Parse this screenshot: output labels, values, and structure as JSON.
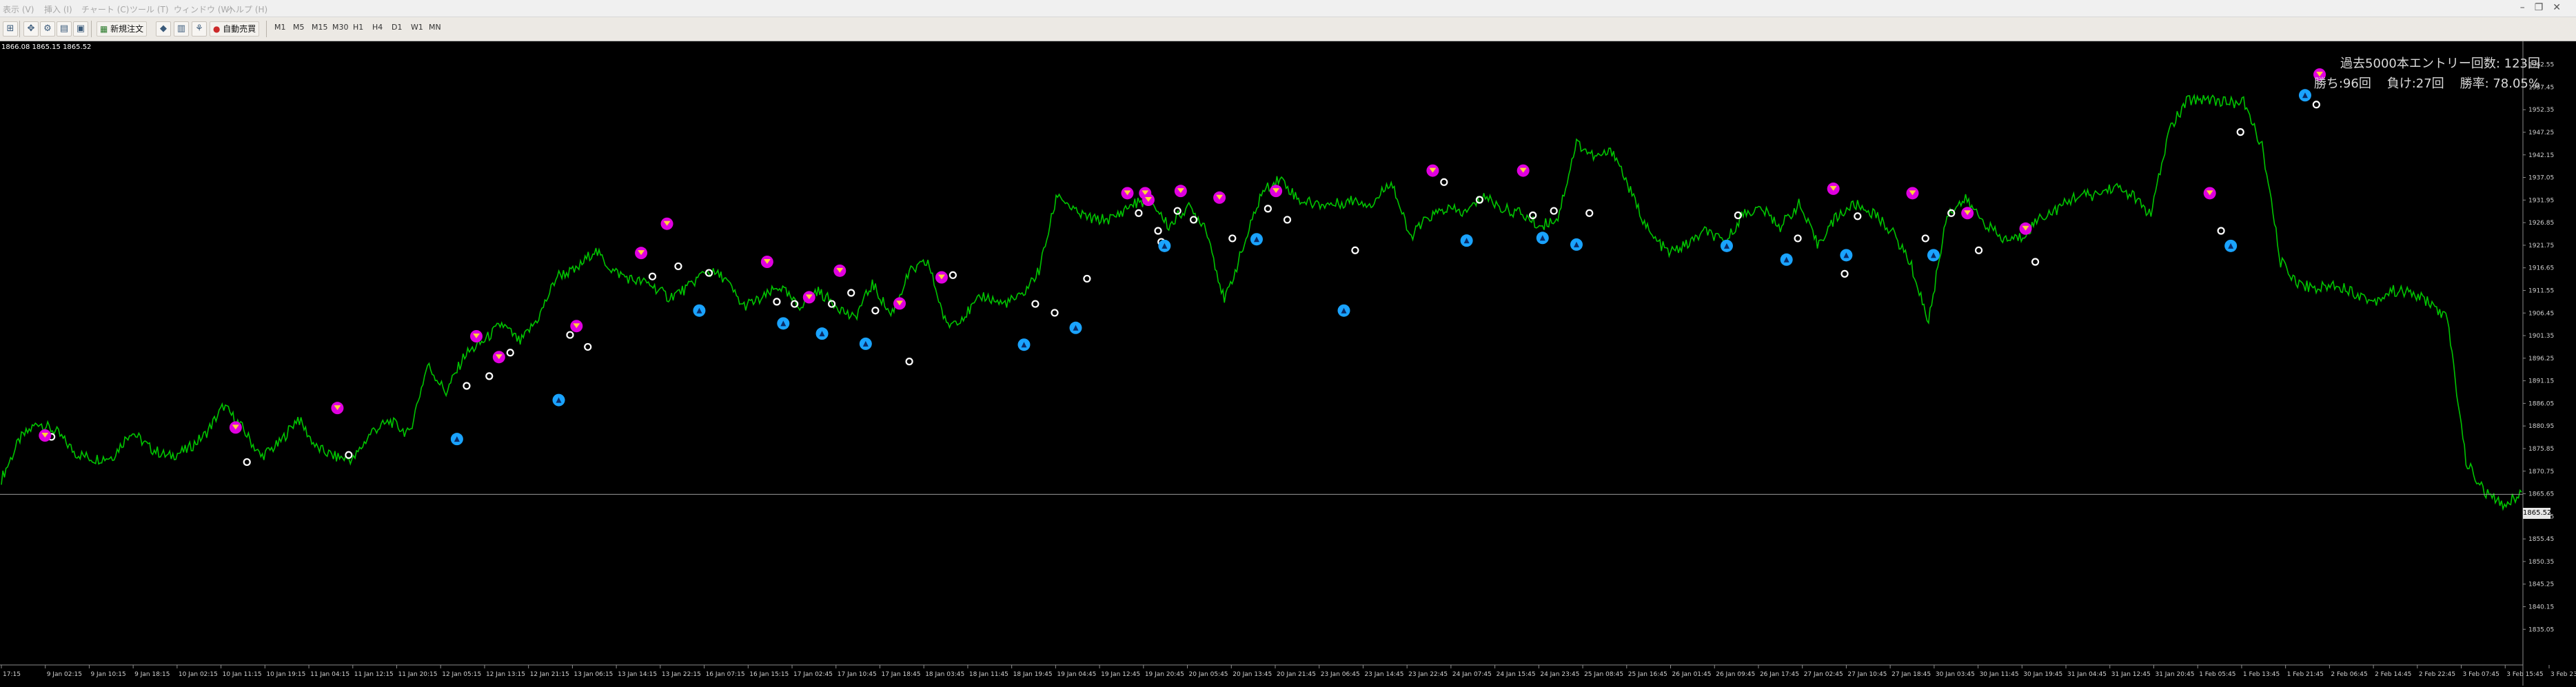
{
  "menu": [
    "表示 (V)",
    "挿入 (I)",
    "チャート (C)",
    "ツール (T)",
    "ウィンドウ (W)",
    "ヘルプ (H)"
  ],
  "window_controls": [
    "–",
    "❐",
    "✕"
  ],
  "toolbar": {
    "new_order_label": "新規注文",
    "auto_trade_label": "自動売買",
    "timeframes": [
      "M1",
      "M5",
      "M15",
      "M30",
      "H1",
      "H4",
      "D1",
      "W1",
      "MN"
    ]
  },
  "chart": {
    "ohlc_text": "1866.08 1865.15 1865.52",
    "current_price": "1865.52",
    "stats": {
      "line1": "過去5000本エントリー回数: 123回",
      "line2": "勝ち:96回    負け:27回    勝率: 78.05%"
    },
    "colors": {
      "background": "#000000",
      "candles": "#00c400",
      "sell_marker": "#e000e0",
      "buy_marker": "#1aa3ff",
      "exit_marker": "#ffffff"
    }
  },
  "chart_data": {
    "type": "line",
    "title": "",
    "series": [
      {
        "name": "",
        "values": [
          1869.0,
          1878.0,
          1881.8,
          1879.5,
          1874.8,
          1873.5,
          1874.0,
          1879.8,
          1876.0,
          1874.0,
          1875.5,
          1879.0,
          1885.5,
          1880.5,
          1874.0,
          1877.0,
          1882.8,
          1876.0,
          1874.0,
          1873.4,
          1879.8,
          1882.0,
          1879.0,
          1894.8,
          1888.5,
          1897.0,
          1900.0,
          1904.0,
          1899.8,
          1905.5,
          1915.0,
          1916.0,
          1920.7,
          1916.0,
          1914.0,
          1913.0,
          1910.0,
          1912.0,
          1916.0,
          1914.5,
          1908.0,
          1909.5,
          1912.5,
          1907.8,
          1911.5,
          1908.5,
          1905.0,
          1913.0,
          1906.0,
          1915.6,
          1918.0,
          1903.5,
          1906.0,
          1910.4,
          1908.5,
          1910.0,
          1916.0,
          1933.5,
          1929.0,
          1927.5,
          1927.8,
          1931.0,
          1932.0,
          1926.0,
          1930.5,
          1926.0,
          1909.0,
          1921.0,
          1933.5,
          1937.0,
          1932.0,
          1931.0,
          1931.0,
          1932.0,
          1931.0,
          1936.5,
          1923.5,
          1928.0,
          1930.0,
          1929.0,
          1933.0,
          1930.0,
          1929.0,
          1926.0,
          1928.0,
          1945.0,
          1941.5,
          1943.0,
          1933.0,
          1924.0,
          1920.0,
          1922.0,
          1925.0,
          1922.0,
          1929.0,
          1930.0,
          1926.0,
          1931.0,
          1922.0,
          1928.0,
          1931.0,
          1929.0,
          1925.0,
          1918.0,
          1904.5,
          1929.0,
          1932.0,
          1927.0,
          1923.0,
          1923.5,
          1928.0,
          1930.0,
          1933.0,
          1933.0,
          1935.0,
          1933.0,
          1928.5,
          1948.0,
          1954.5,
          1955.0,
          1954.0,
          1954.0,
          1944.0,
          1918.0,
          1913.0,
          1912.0,
          1913.0,
          1911.0,
          1909.0,
          1911.5,
          1911.0,
          1909.0,
          1905.0,
          1873.0,
          1866.0,
          1863.0,
          1866.0
        ]
      }
    ],
    "ylim": [
      1827.0,
      1967.0
    ],
    "y_ticks": [
      "1962.55",
      "1957.45",
      "1952.35",
      "1947.25",
      "1942.15",
      "1937.05",
      "1931.95",
      "1926.85",
      "1921.75",
      "1916.65",
      "1911.55",
      "1906.45",
      "1901.35",
      "1896.25",
      "1891.15",
      "1886.05",
      "1880.95",
      "1875.85",
      "1870.75",
      "1865.65",
      "1860.55",
      "1855.45",
      "1850.35",
      "1845.25",
      "1840.15",
      "1835.05"
    ],
    "x_ticks": [
      "9 Jan 02:15",
      "9 Jan 10:15",
      "9 Jan 18:15",
      "10 Jan 02:15",
      "10 Jan 11:15",
      "10 Jan 19:15",
      "11 Jan 04:15",
      "11 Jan 12:15",
      "11 Jan 20:15",
      "12 Jan 05:15",
      "12 Jan 13:15",
      "12 Jan 21:15",
      "13 Jan 06:15",
      "13 Jan 14:15",
      "13 Jan 22:15",
      "16 Jan 07:15",
      "16 Jan 15:15",
      "17 Jan 02:45",
      "17 Jan 10:45",
      "17 Jan 18:45",
      "18 Jan 03:45",
      "18 Jan 11:45",
      "18 Jan 19:45",
      "19 Jan 04:45",
      "19 Jan 12:45",
      "19 Jan 20:45",
      "20 Jan 05:45",
      "20 Jan 13:45",
      "20 Jan 21:45",
      "23 Jan 06:45",
      "23 Jan 14:45",
      "23 Jan 22:45",
      "24 Jan 07:45",
      "24 Jan 15:45",
      "24 Jan 23:45",
      "25 Jan 08:45",
      "25 Jan 16:45",
      "26 Jan 01:45",
      "26 Jan 09:45",
      "26 Jan 17:45",
      "27 Jan 02:45",
      "27 Jan 10:45",
      "27 Jan 18:45",
      "30 Jan 03:45",
      "30 Jan 11:45",
      "30 Jan 19:45",
      "31 Jan 04:45",
      "31 Jan 12:45",
      "31 Jan 20:45",
      "1 Feb 05:45",
      "1 Feb 13:45",
      "1 Feb 21:45",
      "2 Feb 06:45",
      "2 Feb 14:45",
      "2 Feb 22:45",
      "3 Feb 07:45",
      "3 Feb 15:45"
    ],
    "first_x_label": "17:15",
    "last_x_label": "3 Feb 23:",
    "legend": "none",
    "grid": false,
    "markers": {
      "sell_signals": [
        [
          27,
          1878.8
        ],
        [
          145,
          1880.6
        ],
        [
          208,
          1885.0
        ],
        [
          294,
          1901.2
        ],
        [
          308,
          1896.5
        ],
        [
          356,
          1903.5
        ],
        [
          396,
          1920.0
        ],
        [
          412,
          1926.6
        ],
        [
          474,
          1918.0
        ],
        [
          500,
          1910.0
        ],
        [
          519,
          1916.0
        ],
        [
          556,
          1908.6
        ],
        [
          582,
          1914.5
        ],
        [
          697,
          1933.5
        ],
        [
          708,
          1933.5
        ],
        [
          710,
          1932.0
        ],
        [
          730,
          1934.0
        ],
        [
          754,
          1932.5
        ],
        [
          789,
          1934.0
        ],
        [
          886,
          1938.6
        ],
        [
          942,
          1938.6
        ],
        [
          1134,
          1934.5
        ],
        [
          1183,
          1933.5
        ],
        [
          1217,
          1929.0
        ],
        [
          1253,
          1925.5
        ],
        [
          1367,
          1933.5
        ],
        [
          1435,
          1960.3
        ]
      ],
      "buy_signals": [
        [
          282,
          1878.0
        ],
        [
          345,
          1886.8
        ],
        [
          432,
          1907.0
        ],
        [
          484,
          1904.1
        ],
        [
          508,
          1901.8
        ],
        [
          535,
          1899.5
        ],
        [
          633,
          1899.3
        ],
        [
          665,
          1903.1
        ],
        [
          720,
          1921.6
        ],
        [
          777,
          1923.1
        ],
        [
          831,
          1907.0
        ],
        [
          907,
          1922.8
        ],
        [
          954,
          1923.4
        ],
        [
          975,
          1921.9
        ],
        [
          1068,
          1921.6
        ],
        [
          1105,
          1918.5
        ],
        [
          1142,
          1919.5
        ],
        [
          1196,
          1919.5
        ],
        [
          1380,
          1921.6
        ],
        [
          1426,
          1955.6
        ]
      ],
      "exits": [
        [
          31,
          1878.5
        ],
        [
          152,
          1872.8
        ],
        [
          215,
          1874.4
        ],
        [
          288,
          1890.0
        ],
        [
          302,
          1892.2
        ],
        [
          315,
          1897.5
        ],
        [
          352,
          1901.5
        ],
        [
          363,
          1898.8
        ],
        [
          403,
          1914.7
        ],
        [
          419,
          1917.0
        ],
        [
          438,
          1915.5
        ],
        [
          480,
          1909.0
        ],
        [
          491,
          1908.5
        ],
        [
          514,
          1908.5
        ],
        [
          526,
          1911.0
        ],
        [
          541,
          1907.0
        ],
        [
          562,
          1895.5
        ],
        [
          589,
          1915.0
        ],
        [
          640,
          1908.5
        ],
        [
          652,
          1906.5
        ],
        [
          672,
          1914.2
        ],
        [
          704,
          1929.0
        ],
        [
          716,
          1925.0
        ],
        [
          718,
          1922.5
        ],
        [
          728,
          1929.5
        ],
        [
          738,
          1927.5
        ],
        [
          762,
          1923.3
        ],
        [
          784,
          1930.0
        ],
        [
          796,
          1927.5
        ],
        [
          838,
          1920.6
        ],
        [
          893,
          1936.0
        ],
        [
          915,
          1932.0
        ],
        [
          948,
          1928.5
        ],
        [
          961,
          1929.5
        ],
        [
          983,
          1929.0
        ],
        [
          1075,
          1928.5
        ],
        [
          1112,
          1923.3
        ],
        [
          1141,
          1915.3
        ],
        [
          1149,
          1928.3
        ],
        [
          1191,
          1923.3
        ],
        [
          1207,
          1929.0
        ],
        [
          1224,
          1920.6
        ],
        [
          1259,
          1918.0
        ],
        [
          1374,
          1925.0
        ],
        [
          1386,
          1947.3
        ],
        [
          1433,
          1953.5
        ]
      ]
    }
  }
}
